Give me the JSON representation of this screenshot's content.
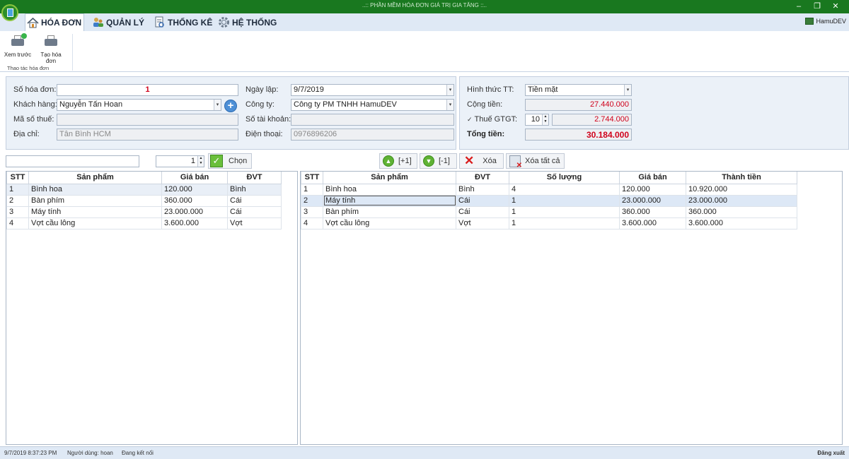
{
  "window": {
    "title": "..:: PHẦN MỀM HÓA ĐƠN GIÁ TRỊ GIA TĂNG ::.."
  },
  "tabs": [
    {
      "label": "HÓA ĐƠN"
    },
    {
      "label": "QUẢN LÝ"
    },
    {
      "label": "THỐNG KÊ"
    },
    {
      "label": "HỆ THỐNG"
    }
  ],
  "user": {
    "name": "HamuDEV"
  },
  "ribbon": {
    "preview_label": "Xem trước",
    "create_label": "Tạo hóa đơn",
    "group_label": "Thao tác hóa đơn"
  },
  "invoice": {
    "number_label": "Số hóa đơn:",
    "number": "1",
    "customer_label": "Khách hàng:",
    "customer": "Nguyễn Tấn Hoan",
    "taxcode_label": "Mã số thuế:",
    "taxcode": "",
    "address_label": "Địa chỉ:",
    "address": "Tân Bình HCM",
    "date_label": "Ngày lập:",
    "date": "9/7/2019",
    "company_label": "Công ty:",
    "company": "Công ty PM TNHH HamuDEV",
    "account_label": "Số tài khoản:",
    "account": "",
    "phone_label": "Điện thoại:",
    "phone": "0976896206"
  },
  "payment": {
    "method_label": "Hình thức TT:",
    "method": "Tiền mặt",
    "subtotal_label": "Cộng tiền:",
    "subtotal": "27.440.000",
    "vat_label": "Thuế GTGT:",
    "vat_rate": "10",
    "vat_amount": "2.744.000",
    "total_label": "Tổng tiền:",
    "total": "30.184.000"
  },
  "toolbar": {
    "search_value": "",
    "qty_value": "1",
    "choose_label": "Chọn",
    "plus_label": "[+1]",
    "minus_label": "[-1]",
    "delete_label": "Xóa",
    "delete_all_label": "Xóa tất cả"
  },
  "products": {
    "columns": [
      "STT",
      "Sản phẩm",
      "Giá bán",
      "ĐVT"
    ],
    "rows": [
      [
        "1",
        "Bình hoa",
        "120.000",
        "Bình"
      ],
      [
        "2",
        "Bàn phím",
        "360.000",
        "Cái"
      ],
      [
        "3",
        "Máy tính",
        "23.000.000",
        "Cái"
      ],
      [
        "4",
        "Vợt cầu lông",
        "3.600.000",
        "Vợt"
      ]
    ]
  },
  "cart": {
    "columns": [
      "STT",
      "Sản phẩm",
      "ĐVT",
      "Số lượng",
      "Giá bán",
      "Thành tiền"
    ],
    "rows": [
      [
        "1",
        "Bình hoa",
        "Bình",
        "4",
        "120.000",
        "10.920.000"
      ],
      [
        "2",
        "Máy tính",
        "Cái",
        "1",
        "23.000.000",
        "23.000.000"
      ],
      [
        "3",
        "Bàn phím",
        "Cái",
        "1",
        "360.000",
        "360.000"
      ],
      [
        "4",
        "Vợt cầu lông",
        "Vợt",
        "1",
        "3.600.000",
        "3.600.000"
      ]
    ]
  },
  "status": {
    "datetime": "9/7/2019 8:37:23 PM",
    "user": "Người dùng: hoan",
    "connection": "Đang kết nối",
    "logout": "Đăng xuất"
  }
}
